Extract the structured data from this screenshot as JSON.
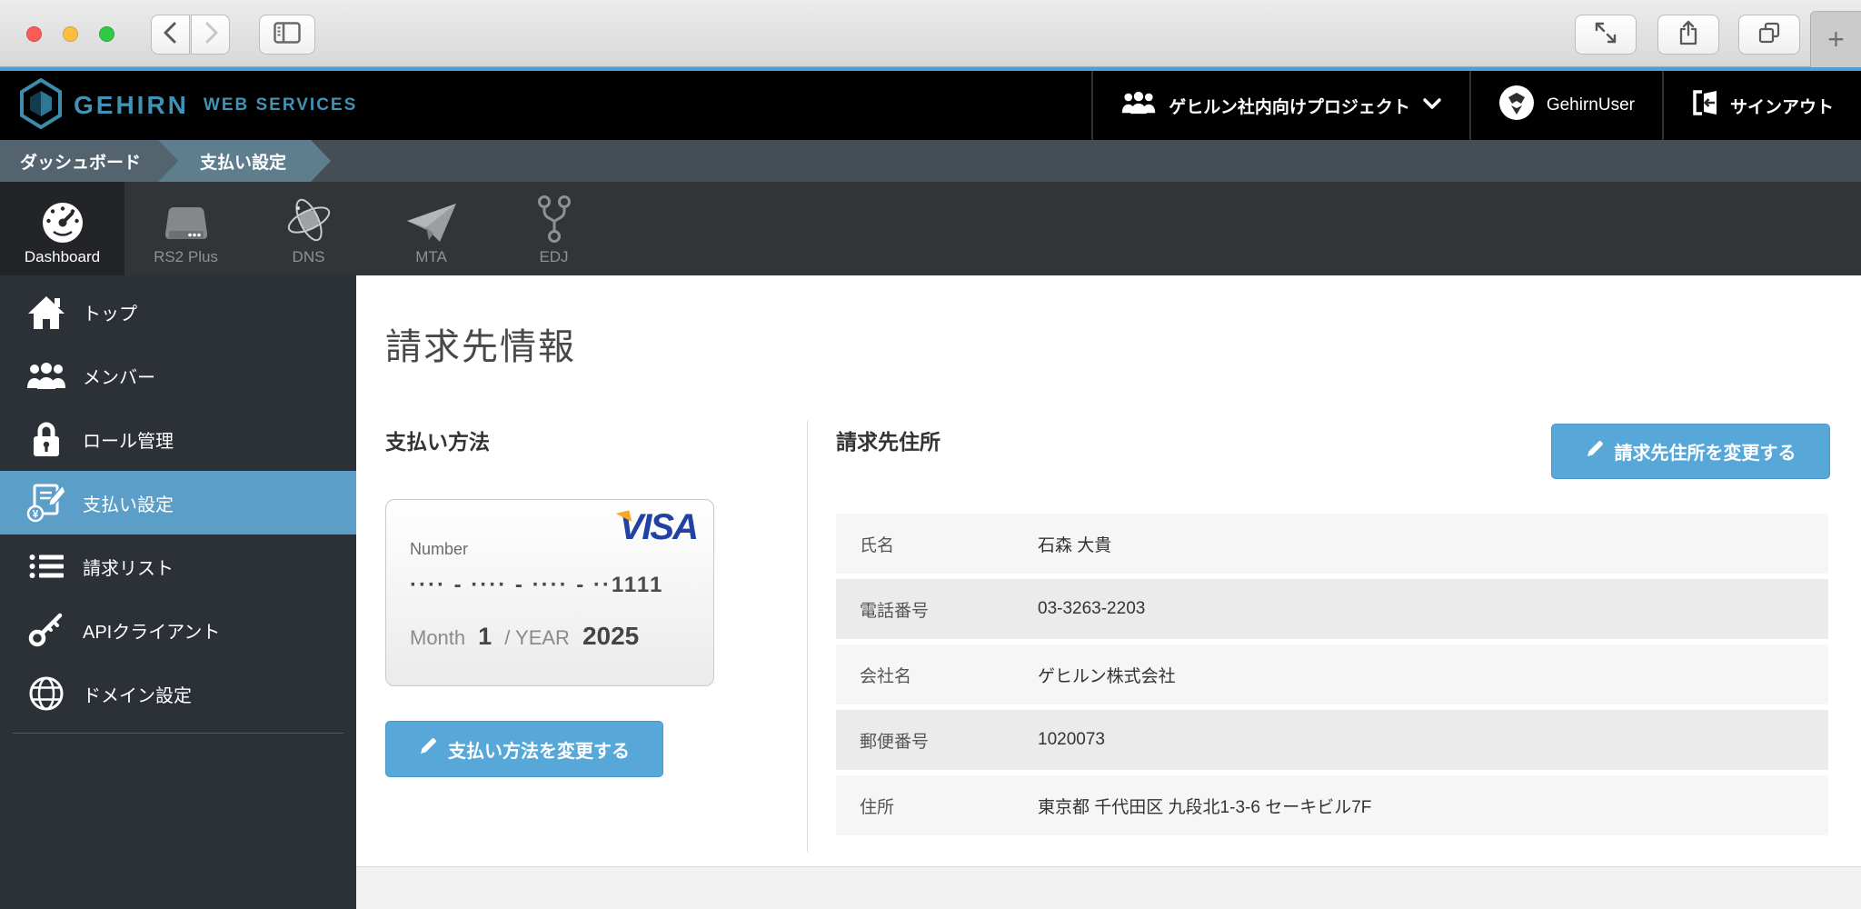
{
  "header": {
    "brand": {
      "name": "GEHIRN",
      "suffix": "WEB SERVICES",
      "logo_icon": "hexagon-logo-icon"
    },
    "project_selector": {
      "label": "ゲヒルン社内向けプロジェクト",
      "icon": "people-icon",
      "chevron_icon": "chevron-down-icon"
    },
    "user": {
      "name": "GehirnUser",
      "icon": "avatar"
    },
    "signout": {
      "label": "サインアウト",
      "icon": "signout-icon"
    }
  },
  "breadcrumb": {
    "items": [
      "ダッシュボード",
      "支払い設定"
    ]
  },
  "app_nav": {
    "items": [
      {
        "label": "Dashboard",
        "icon": "gauge-icon",
        "active": true
      },
      {
        "label": "RS2 Plus",
        "icon": "server-icon",
        "active": false
      },
      {
        "label": "DNS",
        "icon": "atom-icon",
        "active": false
      },
      {
        "label": "MTA",
        "icon": "paper-plane-icon",
        "active": false
      },
      {
        "label": "EDJ",
        "icon": "branch-icon",
        "active": false
      }
    ]
  },
  "sidebar": {
    "items": [
      {
        "label": "トップ",
        "icon": "home-icon",
        "active": false
      },
      {
        "label": "メンバー",
        "icon": "members-icon",
        "active": false
      },
      {
        "label": "ロール管理",
        "icon": "lock-icon",
        "active": false
      },
      {
        "label": "支払い設定",
        "icon": "payment-icon",
        "active": true
      },
      {
        "label": "請求リスト",
        "icon": "list-icon",
        "active": false
      },
      {
        "label": "APIクライアント",
        "icon": "key-icon",
        "active": false
      },
      {
        "label": "ドメイン設定",
        "icon": "globe-icon",
        "active": false
      }
    ]
  },
  "main": {
    "page_title": "請求先情報",
    "payment_method": {
      "heading": "支払い方法",
      "card": {
        "number_label": "Number",
        "brand": "VISA",
        "masked_number": "···· - ···· - ···· - ··1111",
        "month_label": "Month",
        "month_value": "1",
        "year_separator": "/ YEAR",
        "year_value": "2025"
      },
      "change_button": "支払い方法を変更する"
    },
    "billing_address": {
      "heading": "請求先住所",
      "change_button": "請求先住所を変更する",
      "rows": [
        {
          "label": "氏名",
          "value": "石森 大貴"
        },
        {
          "label": "電話番号",
          "value": "03-3263-2203"
        },
        {
          "label": "会社名",
          "value": "ゲヒルン株式会社"
        },
        {
          "label": "郵便番号",
          "value": "1020073"
        },
        {
          "label": "住所",
          "value": "東京都 千代田区 九段北1-3-6 セーキビル7F"
        }
      ]
    }
  },
  "colors": {
    "accent_button_blue": "#57a7d9",
    "sidebar_active_blue": "#5b9ec8",
    "brand_teal": "#3f93b5",
    "top_border_blue": "#4f9fd6",
    "visa_blue": "#2141a3",
    "visa_orange": "#f7a823",
    "breadcrumb_segment1": "#53646e",
    "breadcrumb_segment2": "#5e7e8e"
  }
}
